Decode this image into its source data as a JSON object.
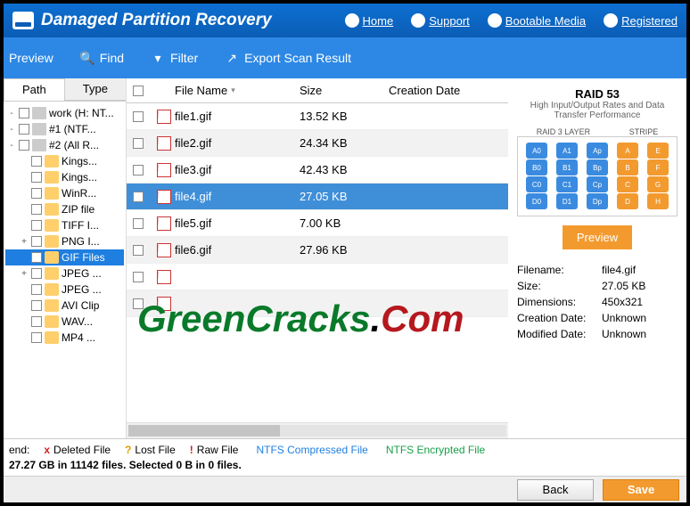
{
  "header": {
    "title": "Damaged Partition Recovery",
    "links": [
      "Home",
      "Support",
      "Bootable Media",
      "Registered"
    ]
  },
  "toolbar": {
    "preview": "Preview",
    "find": "Find",
    "filter": "Filter",
    "export": "Export Scan Result"
  },
  "tabs": {
    "path": "Path",
    "type": "Type"
  },
  "tree": [
    {
      "label": "work (H: NT...",
      "icon": "drv",
      "exp": "-"
    },
    {
      "label": "#1 (NTF...",
      "icon": "drv",
      "exp": "-"
    },
    {
      "label": "#2 (All R...",
      "icon": "drv",
      "exp": "-"
    },
    {
      "label": "Kings...",
      "icon": "f",
      "indent": 1
    },
    {
      "label": "Kings...",
      "icon": "f",
      "indent": 1
    },
    {
      "label": "WinR...",
      "icon": "f",
      "indent": 1
    },
    {
      "label": "ZIP file",
      "icon": "f",
      "indent": 1
    },
    {
      "label": "TIFF I...",
      "icon": "f",
      "indent": 1
    },
    {
      "label": "PNG I...",
      "icon": "f",
      "indent": 1,
      "exp": "+"
    },
    {
      "label": "GIF Files",
      "icon": "f",
      "indent": 1,
      "sel": true
    },
    {
      "label": "JPEG ...",
      "icon": "f",
      "indent": 1,
      "exp": "+"
    },
    {
      "label": "JPEG ...",
      "icon": "f",
      "indent": 1
    },
    {
      "label": "AVI Clip",
      "icon": "f",
      "indent": 1
    },
    {
      "label": "WAV...",
      "icon": "f",
      "indent": 1
    },
    {
      "label": "MP4 ...",
      "icon": "f",
      "indent": 1
    }
  ],
  "columns": {
    "c1": "File Name",
    "c2": "Size",
    "c3": "Creation Date"
  },
  "files": [
    {
      "name": "file1.gif",
      "size": "13.52 KB"
    },
    {
      "name": "file2.gif",
      "size": "24.34 KB"
    },
    {
      "name": "file3.gif",
      "size": "42.43 KB"
    },
    {
      "name": "file4.gif",
      "size": "27.05 KB",
      "sel": true
    },
    {
      "name": "file5.gif",
      "size": "7.00 KB"
    },
    {
      "name": "file6.gif",
      "size": "27.96 KB"
    },
    {
      "name": "",
      "size": ""
    },
    {
      "name": "",
      "size": ""
    }
  ],
  "raid": {
    "title": "RAID 53",
    "sub": "High Input/Output Rates and Data Transfer Performance",
    "l1": "RAID 3 LAYER",
    "l2": "STRIPE",
    "cyl": [
      [
        "A0",
        "B0",
        "C0",
        "D0"
      ],
      [
        "A1",
        "B1",
        "C1",
        "D1"
      ],
      [
        "Ap",
        "Bp",
        "Cp",
        "Dp"
      ],
      [
        "A",
        "B",
        "C",
        "D"
      ],
      [
        "E",
        "F",
        "G",
        "H"
      ]
    ]
  },
  "preview_btn": "Preview",
  "meta": [
    {
      "k": "Filename:",
      "v": "file4.gif"
    },
    {
      "k": "Size:",
      "v": "27.05 KB"
    },
    {
      "k": "Dimensions:",
      "v": "450x321"
    },
    {
      "k": "Creation Date:",
      "v": "Unknown"
    },
    {
      "k": "Modified Date:",
      "v": "Unknown"
    }
  ],
  "legend": {
    "end": "end:",
    "items": [
      {
        "m": "x",
        "c": "#cc2222",
        "t": "Deleted File"
      },
      {
        "m": "?",
        "c": "#e09a00",
        "t": "Lost File"
      },
      {
        "m": "!",
        "c": "#cc2222",
        "t": "Raw File"
      },
      {
        "m": "",
        "c": "#1e7fe0",
        "t": "NTFS Compressed File"
      },
      {
        "m": "",
        "c": "#19a04a",
        "t": "NTFS Encrypted File"
      }
    ],
    "status": "27.27 GB in 11142 files. Selected 0 B in 0 files."
  },
  "footer": {
    "back": "Back",
    "save": "Save"
  },
  "watermark": {
    "a": "GreenCracks",
    "b": ".",
    "c": "Com"
  }
}
